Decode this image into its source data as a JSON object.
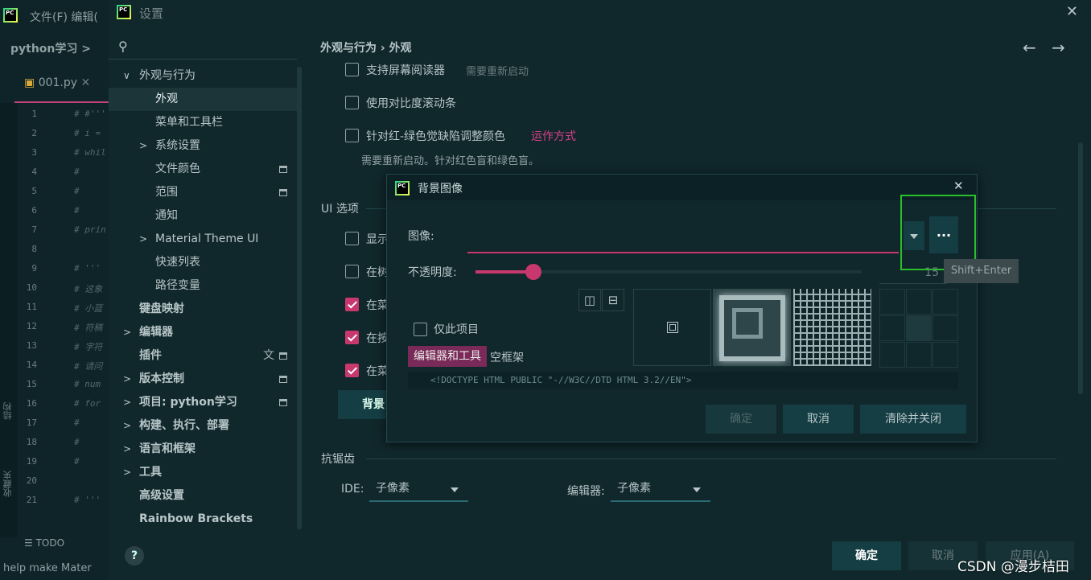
{
  "ide": {
    "menu": "文件(F)  编辑(",
    "project_crumb": "python学习 >",
    "tab": "001.py",
    "line_numbers": [
      "1",
      "2",
      "3",
      "4",
      "5",
      "6",
      "7",
      "8",
      "9",
      "10",
      "11",
      "12",
      "13",
      "14",
      "15",
      "16",
      "17",
      "18",
      "19",
      "20",
      "21"
    ],
    "code_lines": [
      "# #'''",
      "# i =",
      "# whil",
      "#",
      "#",
      "#",
      "# prin",
      "",
      "# '''",
      "# 这象",
      "# 小蓝",
      "# 符稿",
      "# 字符",
      "# 请问",
      "# num",
      "# for",
      "#",
      "#",
      "#",
      "",
      "# '''"
    ],
    "bottom_todo": "TODO",
    "bottom_status": "help make Mater",
    "side_labels": [
      "结构",
      "收藏夹"
    ]
  },
  "settings": {
    "title": "设置",
    "search_placeholder": "",
    "tree": [
      {
        "label": "外观与行为",
        "arrow": "∨",
        "level": 0,
        "bold": false
      },
      {
        "label": "外观",
        "level": 1,
        "selected": true
      },
      {
        "label": "菜单和工具栏",
        "level": 1
      },
      {
        "label": "系统设置",
        "arrow": ">",
        "level": 1
      },
      {
        "label": "文件颜色",
        "level": 1,
        "sq": true
      },
      {
        "label": "范围",
        "level": 1,
        "sq": true
      },
      {
        "label": "通知",
        "level": 1
      },
      {
        "label": "Material Theme UI",
        "arrow": ">",
        "level": 1
      },
      {
        "label": "快速列表",
        "level": 1
      },
      {
        "label": "路径变量",
        "level": 1
      },
      {
        "label": "键盘映射",
        "level": 0,
        "bold": true
      },
      {
        "label": "编辑器",
        "arrow": ">",
        "level": 0,
        "bold": true
      },
      {
        "label": "插件",
        "level": 0,
        "bold": true,
        "sq": true,
        "translate": true
      },
      {
        "label": "版本控制",
        "arrow": ">",
        "level": 0,
        "bold": true,
        "sq": true
      },
      {
        "label": "项目: python学习",
        "arrow": ">",
        "level": 0,
        "bold": true,
        "sq": true
      },
      {
        "label": "构建、执行、部署",
        "arrow": ">",
        "level": 0,
        "bold": true
      },
      {
        "label": "语言和框架",
        "arrow": ">",
        "level": 0,
        "bold": true
      },
      {
        "label": "工具",
        "arrow": ">",
        "level": 0,
        "bold": true
      },
      {
        "label": "高级设置",
        "level": 0,
        "bold": true
      },
      {
        "label": "Rainbow Brackets",
        "level": 0,
        "bold": true
      }
    ],
    "breadcrumb": "外观与行为 › 外观",
    "opt_screen_reader": "支持屏幕阅读器",
    "opt_screen_reader_note": "需要重新启动",
    "opt_contrast_scroll": "使用对比度滚动条",
    "opt_colorblind": "针对红-绿色觉缺陷调整颜色",
    "opt_colorblind_link": "运作方式",
    "opt_colorblind_note": "需要重新启动。针对红色盲和绿色盲。",
    "ui_section": "UI 选项",
    "ui_opts": [
      "显示",
      "在树",
      "在菜",
      "在按",
      "在菜"
    ],
    "ui_opts_checked": [
      false,
      false,
      true,
      true,
      true
    ],
    "bg_button": "背景",
    "aa_section": "抗锯齿",
    "ide_label": "IDE:",
    "ide_value": "子像素",
    "editor_label": "编辑器:",
    "editor_value": "子像素",
    "ok": "确定",
    "cancel": "取消",
    "apply": "应用(A)"
  },
  "dialog": {
    "title": "背景图像",
    "image_label": "图像:",
    "browse": "...",
    "tooltip": "Shift+Enter",
    "opacity_label": "不透明度:",
    "opacity_value": "15",
    "opacity_fraction": 0.15,
    "this_project_only": "仅此项目",
    "tag_editor_tools": "编辑器和工具",
    "empty_frame": "空框架",
    "code_preview": "<!DOCTYPE HTML PUBLIC \"-//W3C//DTD HTML 3.2//EN\">",
    "ok": "确定",
    "cancel": "取消",
    "clear_close": "清除并关闭"
  },
  "watermark": "CSDN @漫步桔田",
  "colors": {
    "accent": "#c8386e",
    "bg": "#10272b",
    "highlight": "#2ac02a"
  }
}
